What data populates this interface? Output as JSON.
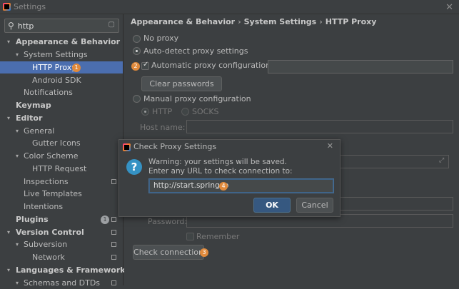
{
  "window": {
    "title": "Settings"
  },
  "search": {
    "value": "http"
  },
  "tree": [
    {
      "label": "Appearance & Behavior",
      "bold": true,
      "arrow": "▾",
      "indent": 0
    },
    {
      "label": "System Settings",
      "arrow": "▾",
      "indent": 1
    },
    {
      "label": "HTTP Proxy",
      "indent": 2,
      "selected": true,
      "badge": "1"
    },
    {
      "label": "Android SDK",
      "indent": 2
    },
    {
      "label": "Notifications",
      "indent": 1
    },
    {
      "label": "Keymap",
      "bold": true,
      "indent": 0
    },
    {
      "label": "Editor",
      "bold": true,
      "arrow": "▾",
      "indent": 0
    },
    {
      "label": "General",
      "arrow": "▾",
      "indent": 1
    },
    {
      "label": "Gutter Icons",
      "indent": 2
    },
    {
      "label": "Color Scheme",
      "arrow": "▾",
      "indent": 1
    },
    {
      "label": "HTTP Request",
      "indent": 2
    },
    {
      "label": "Inspections",
      "indent": 1,
      "proj": true
    },
    {
      "label": "Live Templates",
      "indent": 1
    },
    {
      "label": "Intentions",
      "indent": 1
    },
    {
      "label": "Plugins",
      "bold": true,
      "indent": 0,
      "greybadge": "1",
      "proj": true
    },
    {
      "label": "Version Control",
      "bold": true,
      "arrow": "▾",
      "indent": 0,
      "proj": true
    },
    {
      "label": "Subversion",
      "arrow": "▾",
      "indent": 1,
      "proj": true
    },
    {
      "label": "Network",
      "indent": 2,
      "proj": true
    },
    {
      "label": "Languages & Frameworks",
      "bold": true,
      "arrow": "▾",
      "indent": 0
    },
    {
      "label": "Schemas and DTDs",
      "arrow": "▾",
      "indent": 1,
      "proj": true
    }
  ],
  "breadcrumb": [
    "Appearance & Behavior",
    "System Settings",
    "HTTP Proxy"
  ],
  "proxy": {
    "no_proxy": "No proxy",
    "auto_detect": "Auto-detect proxy settings",
    "auto_config_url": "Automatic proxy configuration URL:",
    "clear_passwords": "Clear passwords",
    "manual": "Manual proxy configuration",
    "http": "HTTP",
    "socks": "SOCKS",
    "host_name": "Host name:",
    "password": "Password:",
    "remember": "Remember",
    "check_connection": "Check connection",
    "badge_step2": "2",
    "badge_step3": "3"
  },
  "dialog": {
    "title": "Check Proxy Settings",
    "warning": "Warning: your settings will be saved.",
    "prompt": "Enter any URL to check connection to:",
    "url": "http://start.spring.io",
    "badge_step4": "4",
    "ok": "OK",
    "cancel": "Cancel"
  },
  "colors": {
    "accent": "#4b6eaf",
    "badge": "#e08a3c",
    "primary_button": "#365880"
  }
}
